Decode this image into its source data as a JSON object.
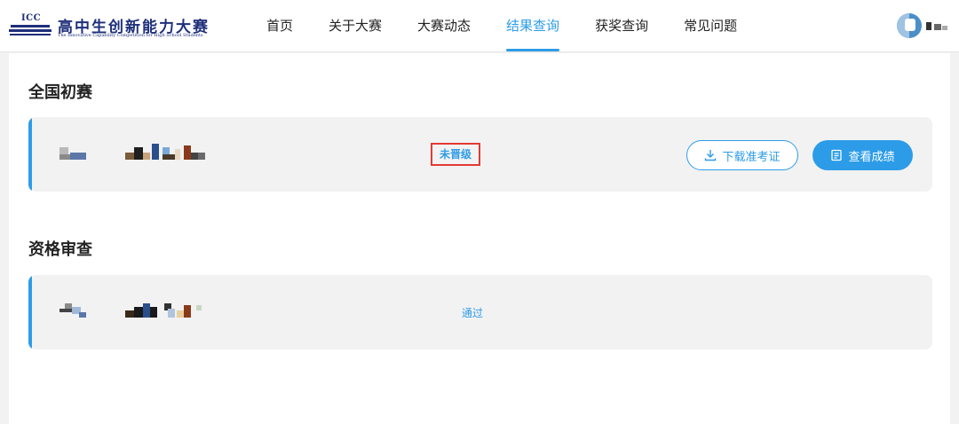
{
  "header": {
    "logo": {
      "abbr": "ICC",
      "title": "高中生创新能力大赛",
      "subtitle": "The Innovative Capability Competition for High School Students"
    },
    "nav": [
      {
        "label": "首页",
        "active": false
      },
      {
        "label": "关于大赛",
        "active": false
      },
      {
        "label": "大赛动态",
        "active": false
      },
      {
        "label": "结果查询",
        "active": true
      },
      {
        "label": "获奖查询",
        "active": false
      },
      {
        "label": "常见问题",
        "active": false
      }
    ]
  },
  "sections": [
    {
      "title": "全国初赛",
      "status": "未晋级",
      "download_label": "下载准考证",
      "view_label": "查看成绩"
    },
    {
      "title": "资格审查",
      "status": "通过"
    }
  ],
  "colors": {
    "accent": "#2d9ce8",
    "highlight_box": "#e53935",
    "brand": "#1e2f7a"
  },
  "icons": {
    "download": "download-icon",
    "scores": "document-icon"
  }
}
